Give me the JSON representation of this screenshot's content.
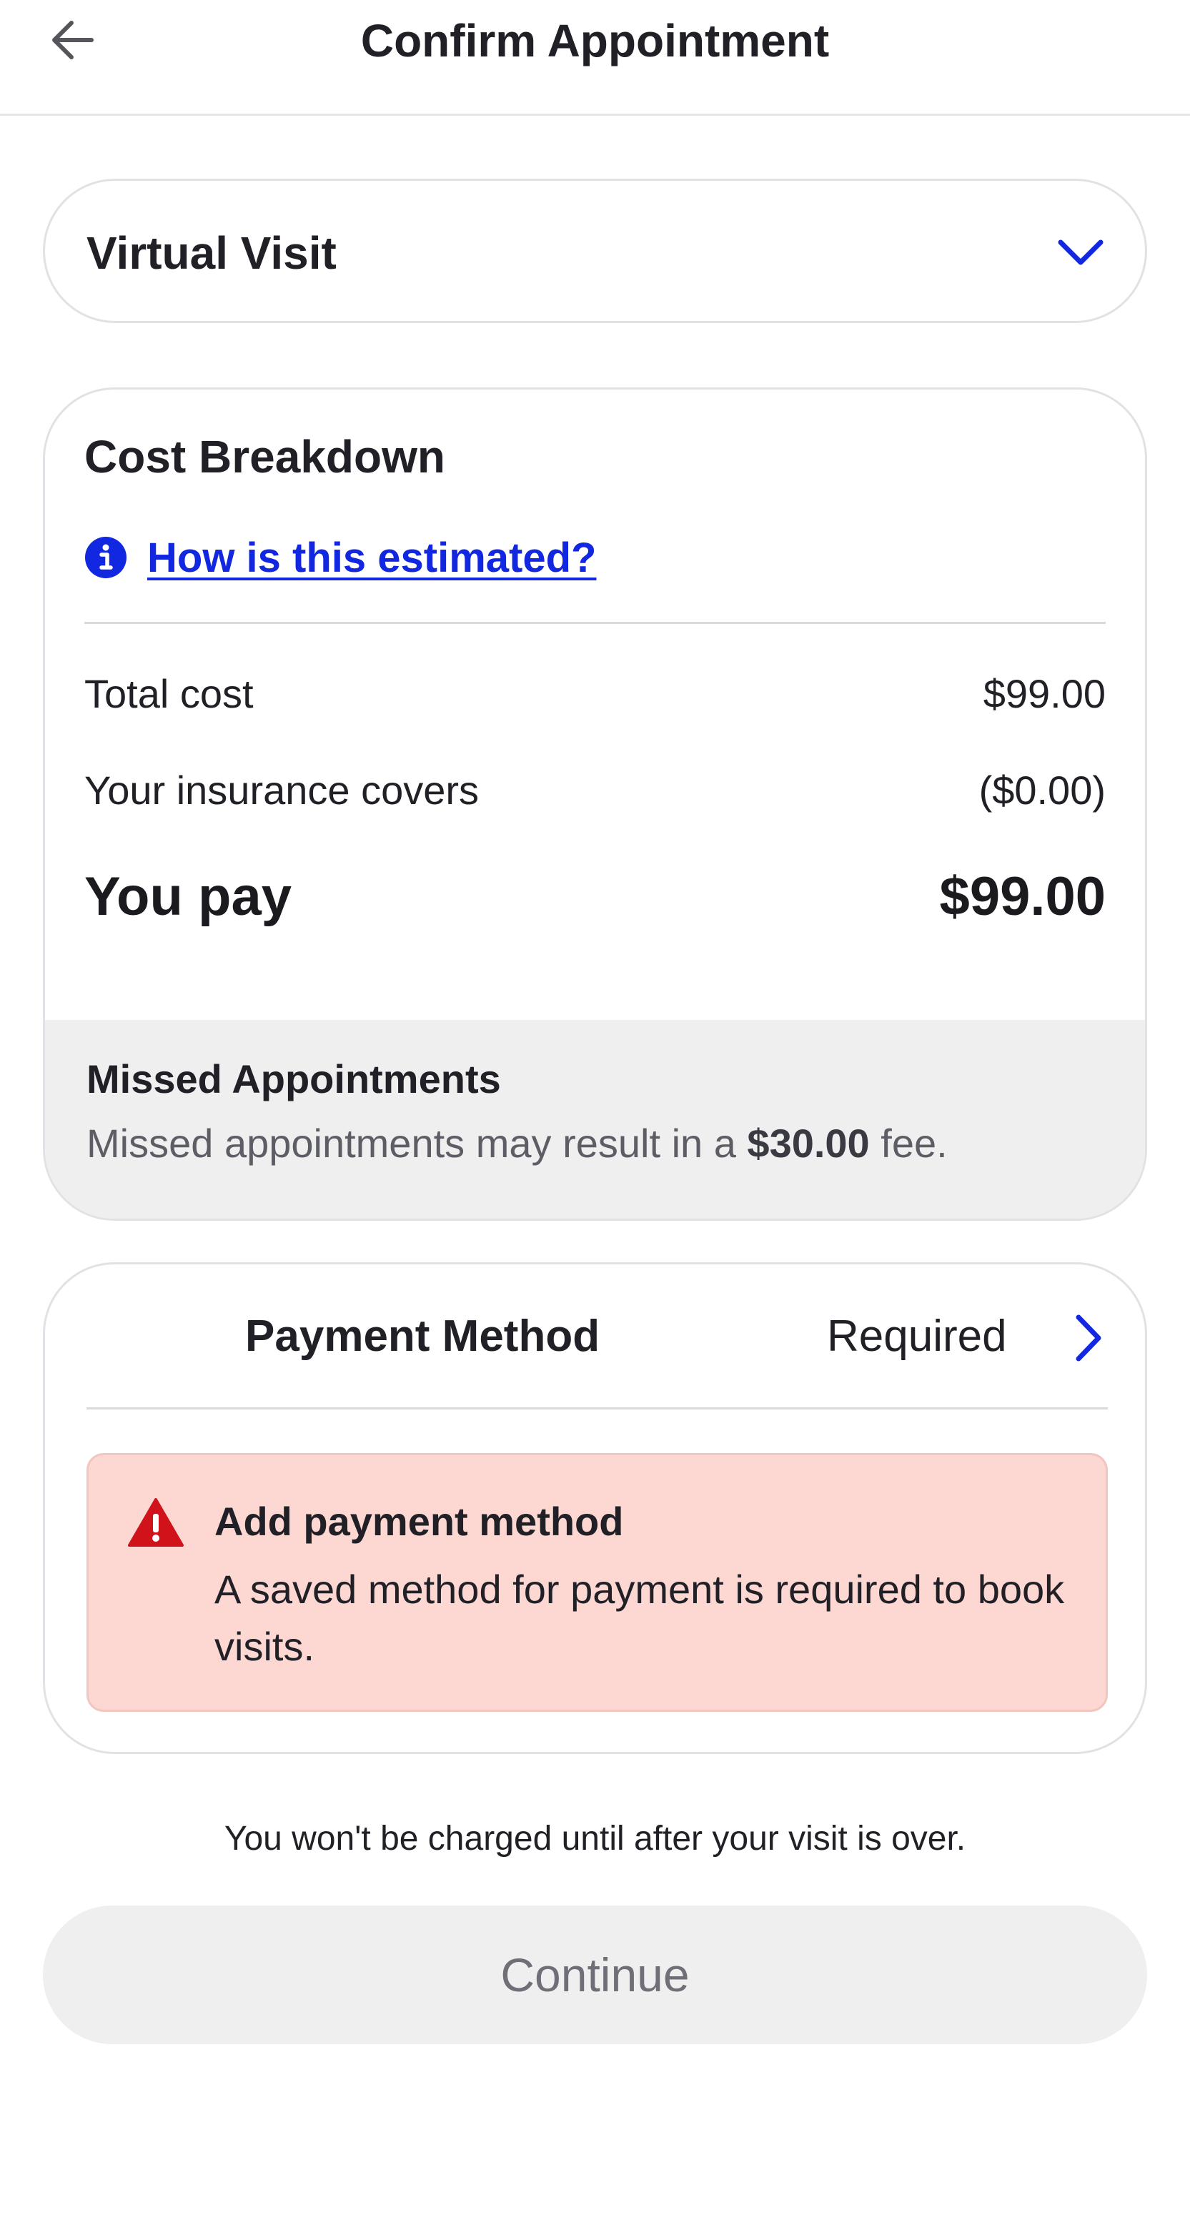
{
  "header": {
    "title": "Confirm Appointment",
    "back_icon": "arrow-left-icon"
  },
  "visit_type": {
    "selected": "Virtual Visit",
    "icon": "chevron-down-icon",
    "accent": "#1227e0"
  },
  "cost_breakdown": {
    "title": "Cost Breakdown",
    "info_link": "How is this estimated?",
    "info_icon": "info-icon",
    "rows": [
      {
        "label": "Total cost",
        "value": "$99.00"
      },
      {
        "label": "Your insurance covers",
        "value": "($0.00)"
      }
    ],
    "you_pay_label": "You pay",
    "you_pay_value": "$99.00"
  },
  "missed": {
    "title": "Missed Appointments",
    "text_before": "Missed appointments may result in a ",
    "fee": "$30.00",
    "text_after": " fee."
  },
  "payment": {
    "label": "Payment Method",
    "status": "Required",
    "chevron_icon": "chevron-right-icon",
    "alert": {
      "icon": "warning-icon",
      "color": "#d0121b",
      "background": "#fdd7d2",
      "title": "Add payment method",
      "text": "A saved method for payment is required to book visits."
    }
  },
  "footer": {
    "note": "You won't be charged until after your visit is over.",
    "continue_label": "Continue"
  }
}
